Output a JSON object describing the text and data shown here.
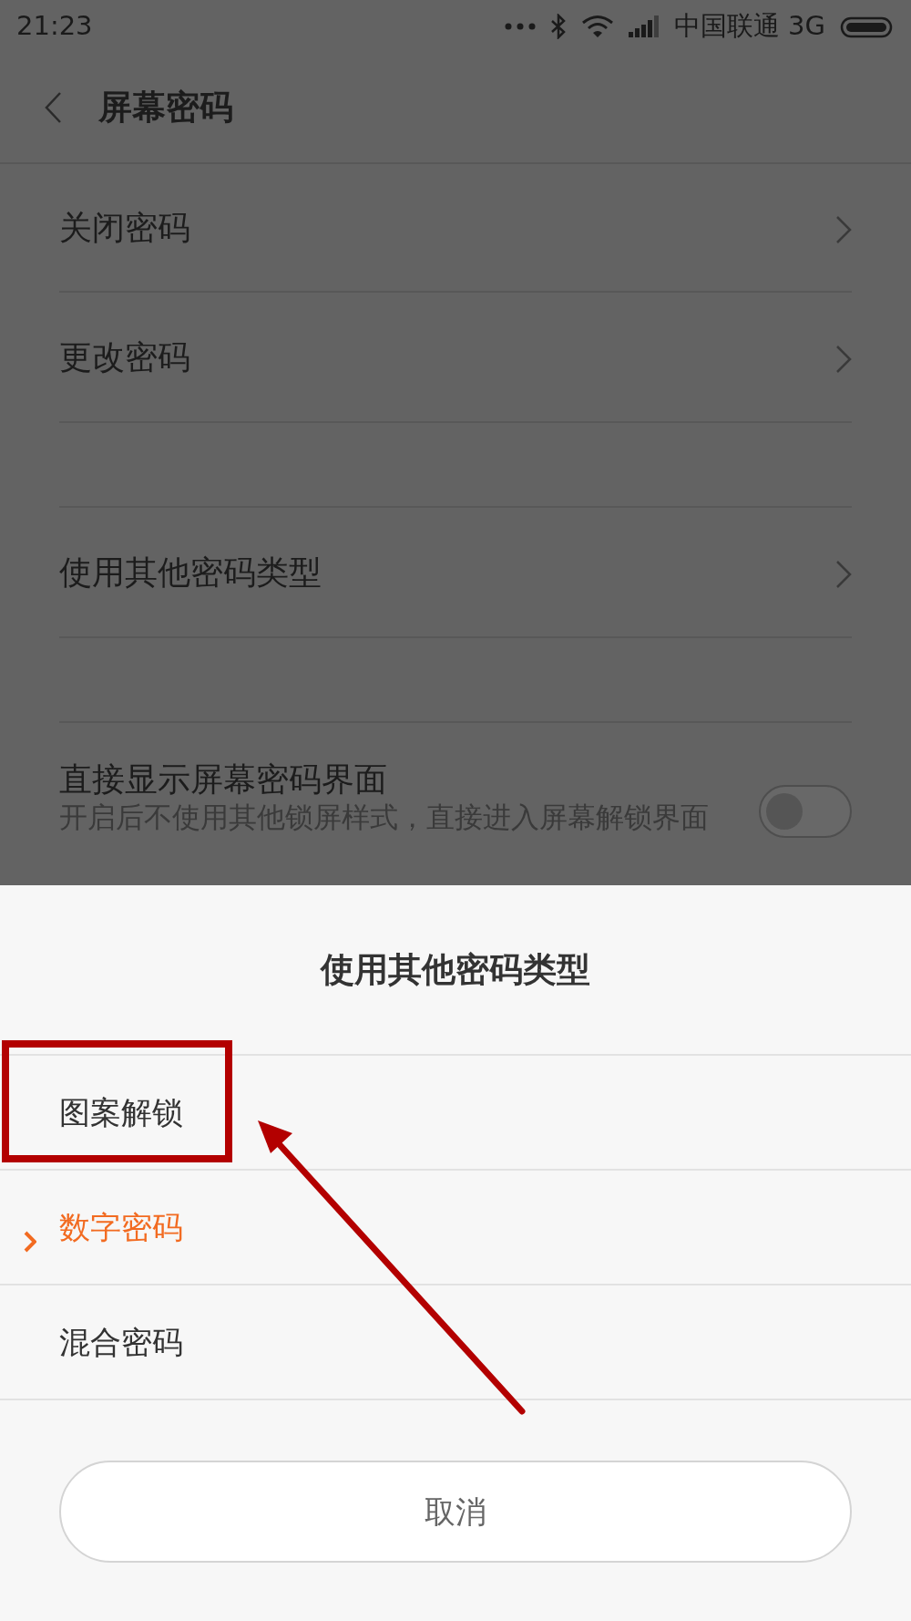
{
  "status_bar": {
    "time": "21:23",
    "carrier": "中国联通 3G"
  },
  "header": {
    "title": "屏幕密码"
  },
  "groups": [
    [
      {
        "kind": "link",
        "label": "关闭密码"
      },
      {
        "kind": "link",
        "label": "更改密码"
      }
    ],
    [
      {
        "kind": "link",
        "label": "使用其他密码类型"
      }
    ],
    [
      {
        "kind": "toggle",
        "label": "直接显示屏幕密码界面",
        "description": "开启后不使用其他锁屏样式，直接进入屏幕解锁界面",
        "on": false
      }
    ]
  ],
  "sheet": {
    "title": "使用其他密码类型",
    "options": [
      {
        "label": "图案解锁",
        "selected": false
      },
      {
        "label": "数字密码",
        "selected": true
      },
      {
        "label": "混合密码",
        "selected": false
      }
    ],
    "cancel": "取消"
  }
}
